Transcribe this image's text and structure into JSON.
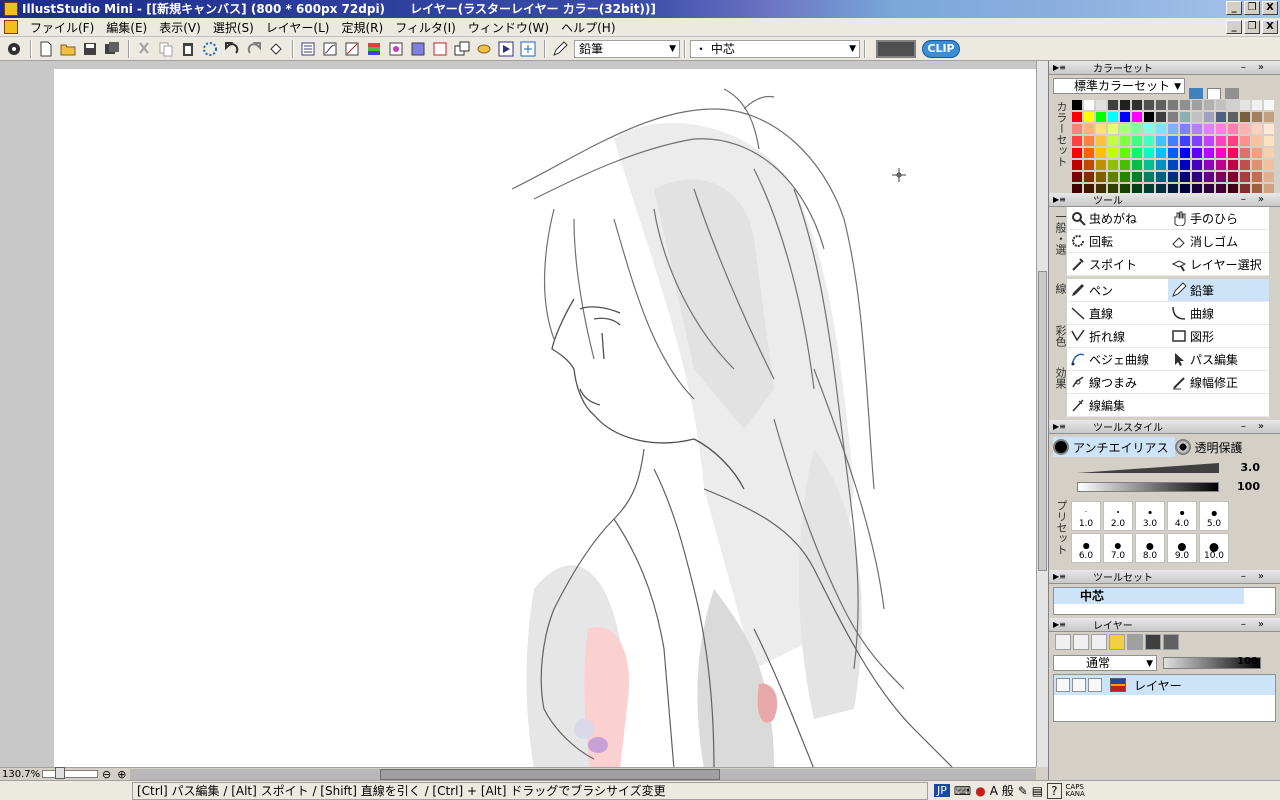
{
  "window": {
    "title": "IllustStudio Mini - [[新規キャンバス] (800 * 600px 72dpi)      レイヤー(ラスターレイヤー カラー(32bit))]",
    "controls": [
      "_",
      "❐",
      "X"
    ]
  },
  "menu": {
    "items": [
      "ファイル(F)",
      "編集(E)",
      "表示(V)",
      "選択(S)",
      "レイヤー(L)",
      "定規(R)",
      "フィルタ(I)",
      "ウィンドウ(W)",
      "ヘルプ(H)"
    ]
  },
  "toolbar": {
    "tool_label": "鉛筆",
    "brush_label": "・ 中芯",
    "badge": "CLIP",
    "current_color": "#505050"
  },
  "canvas": {
    "zoom": "130.7%",
    "background": "#ffffff"
  },
  "status": {
    "hint": "[Ctrl] パス編集 / [Alt] スポイト / [Shift] 直線を引く / [Ctrl] + [Alt] ドラッグでブラシサイズ変更",
    "ime_mode": "JP",
    "ime_chars": "A 般",
    "caps": "CAPS",
    "kana": "KANA"
  },
  "colorset_panel": {
    "title": "カラーセット",
    "set_name": "標準カラーセット",
    "side_label": "カラーセット",
    "palette": [
      "#000000",
      "#ffffff",
      "#e0e0e0",
      "#404040",
      "#202020",
      "#303030",
      "#505050",
      "#606060",
      "#7a7a7a",
      "#909090",
      "#a0a0a0",
      "#b0b0b0",
      "#c0c0c0",
      "#d0d0d0",
      "#e4e4e4",
      "#f0f0f0",
      "#f8f8f8",
      "#ff0000",
      "#ffff00",
      "#00ff00",
      "#00ffff",
      "#0000ff",
      "#ff00ff",
      "#000000",
      "#404040",
      "#808080",
      "#8ab0b0",
      "#c0c0c0",
      "#a0a0c0",
      "#506080",
      "#606060",
      "#7a6040",
      "#a08060",
      "#c0a080",
      "#ff8080",
      "#ffb080",
      "#ffe080",
      "#e0ff80",
      "#b0ff80",
      "#80ffa0",
      "#80ffe0",
      "#80e0ff",
      "#80b0ff",
      "#8080ff",
      "#b080ff",
      "#e080ff",
      "#ff80e0",
      "#ff80b0",
      "#ffb0b0",
      "#ffd0c0",
      "#ffe8d8",
      "#ff4040",
      "#ff8040",
      "#ffc040",
      "#c0ff40",
      "#80ff40",
      "#40ff80",
      "#40ffc0",
      "#40c0ff",
      "#4080ff",
      "#4040ff",
      "#8040ff",
      "#c040ff",
      "#ff40c0",
      "#ff4080",
      "#ff9090",
      "#ffc0a0",
      "#ffe0c0",
      "#ff0000",
      "#ff6000",
      "#ffc000",
      "#c0ff00",
      "#60ff00",
      "#00ff60",
      "#00ffc0",
      "#00c0ff",
      "#0060ff",
      "#0000ff",
      "#6000ff",
      "#c000ff",
      "#ff00c0",
      "#ff0060",
      "#e07070",
      "#f0a080",
      "#f8d0b0",
      "#c00000",
      "#c04800",
      "#c09000",
      "#90c000",
      "#48c000",
      "#00c048",
      "#00c090",
      "#0090c0",
      "#0048c0",
      "#0000c0",
      "#4800c0",
      "#9000c0",
      "#c00090",
      "#c00048",
      "#c05050",
      "#e09070",
      "#f0c0a0",
      "#800000",
      "#803000",
      "#806000",
      "#608000",
      "#308000",
      "#008030",
      "#008060",
      "#006080",
      "#003080",
      "#000080",
      "#300080",
      "#600080",
      "#800060",
      "#800030",
      "#a04040",
      "#c07050",
      "#e0b090",
      "#400000",
      "#401800",
      "#403000",
      "#304000",
      "#184000",
      "#004018",
      "#004030",
      "#003040",
      "#001840",
      "#000040",
      "#180040",
      "#300040",
      "#400030",
      "#400018",
      "#803030",
      "#a06040",
      "#d0a080"
    ]
  },
  "tool_panel": {
    "title": "ツール",
    "section_labels": [
      "一般・選",
      "線",
      "彩色",
      "効果"
    ],
    "rows": [
      [
        {
          "label": "虫めがね",
          "icon": "magnifier-icon"
        },
        {
          "label": "手のひら",
          "icon": "hand-icon"
        }
      ],
      [
        {
          "label": "回転",
          "icon": "rotate-icon"
        },
        {
          "label": "消しゴム",
          "icon": "eraser-icon"
        }
      ],
      [
        {
          "label": "スポイト",
          "icon": "eyedropper-icon"
        },
        {
          "label": "レイヤー選択",
          "icon": "layer-select-icon"
        }
      ],
      [
        {
          "label": "ペン",
          "icon": "pen-icon"
        },
        {
          "label": "鉛筆",
          "icon": "pencil-icon"
        }
      ],
      [
        {
          "label": "直線",
          "icon": "line-icon"
        },
        {
          "label": "曲線",
          "icon": "curve-icon"
        }
      ],
      [
        {
          "label": "折れ線",
          "icon": "polyline-icon"
        },
        {
          "label": "図形",
          "icon": "shape-icon"
        }
      ],
      [
        {
          "label": "ベジェ曲線",
          "icon": "bezier-icon"
        },
        {
          "label": "パス編集",
          "icon": "path-edit-icon"
        }
      ],
      [
        {
          "label": "線つまみ",
          "icon": "line-pinch-icon"
        },
        {
          "label": "線幅修正",
          "icon": "line-width-icon"
        }
      ],
      [
        {
          "label": "線編集",
          "icon": "line-edit-icon"
        },
        {
          "label": "",
          "icon": ""
        }
      ]
    ],
    "selected": "鉛筆"
  },
  "toolstyle_panel": {
    "title": "ツールスタイル",
    "antialias": "アンチエイリアス",
    "protect": "透明保護",
    "size_value": "3.0",
    "opacity_value": "100",
    "preset_label": "プリセット",
    "presets": [
      "1.0",
      "2.0",
      "3.0",
      "4.0",
      "5.0",
      "6.0",
      "7.0",
      "8.0",
      "9.0",
      "10.0"
    ]
  },
  "toolset_panel": {
    "title": "ツールセット",
    "item": "中芯"
  },
  "layer_panel": {
    "title": "レイヤー",
    "blend_mode": "通常",
    "opacity": "100",
    "layer_name": "レイヤー"
  }
}
